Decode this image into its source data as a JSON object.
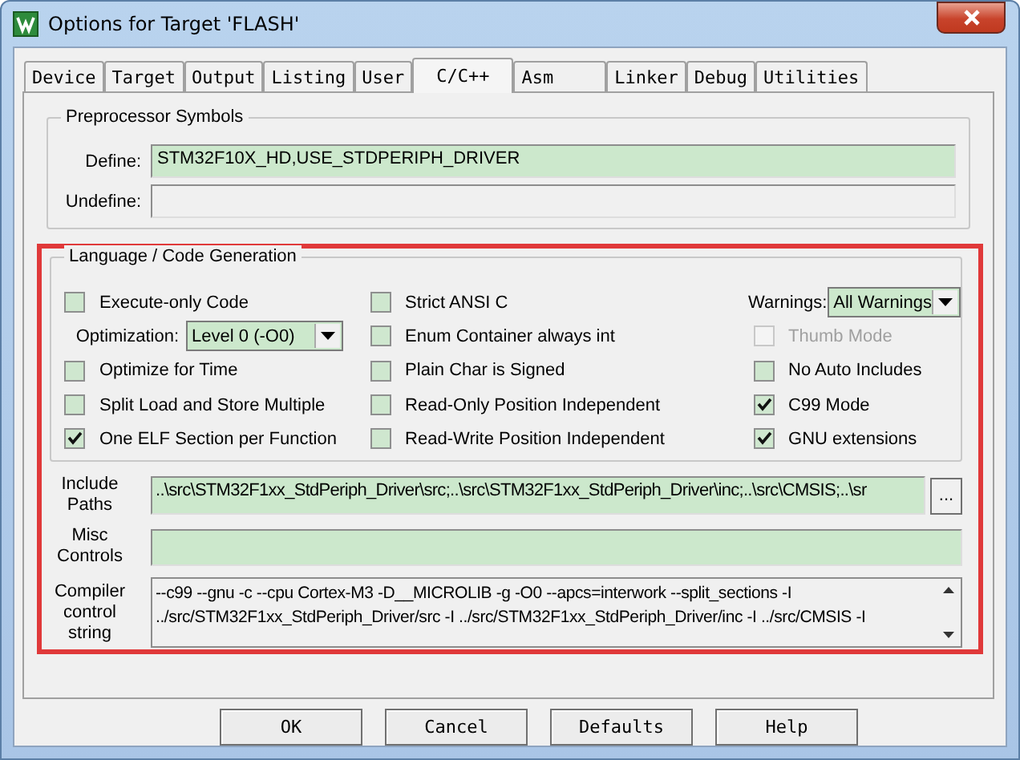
{
  "window": {
    "title": "Options for Target 'FLASH'"
  },
  "tabs": [
    {
      "label": "Device",
      "selected": false
    },
    {
      "label": "Target",
      "selected": false
    },
    {
      "label": "Output",
      "selected": false
    },
    {
      "label": "Listing",
      "selected": false
    },
    {
      "label": "User",
      "selected": false
    },
    {
      "label": "C/C++",
      "selected": true
    },
    {
      "label": "Asm",
      "selected": false
    },
    {
      "label": "Linker",
      "selected": false
    },
    {
      "label": "Debug",
      "selected": false
    },
    {
      "label": "Utilities",
      "selected": false
    }
  ],
  "preprocessor": {
    "title": "Preprocessor Symbols",
    "fields": [
      {
        "label": "Define:",
        "value": "STM32F10X_HD,USE_STDPERIPH_DRIVER",
        "disabled": false
      },
      {
        "label": "Undefine:",
        "disabled": true
      }
    ]
  },
  "language": {
    "title": "Language / Code Generation",
    "highlighted": true,
    "columns": [
      {
        "items": [
          {
            "kind": "checkbox",
            "label": "Execute-only Code",
            "checked": false,
            "disabled": false
          },
          {
            "kind": "dropdown",
            "label": "Optimization:",
            "value": "Level 0 (-O0)"
          },
          {
            "kind": "checkbox",
            "label": "Optimize for Time",
            "checked": false,
            "disabled": false
          },
          {
            "kind": "checkbox",
            "label": "Split Load and Store Multiple",
            "checked": false,
            "disabled": false
          },
          {
            "kind": "checkbox",
            "label": "One ELF Section per Function",
            "checked": true,
            "disabled": false
          }
        ]
      },
      {
        "items": [
          {
            "kind": "checkbox",
            "label": "Strict ANSI C",
            "checked": false,
            "disabled": false
          },
          {
            "kind": "checkbox",
            "label": "Enum Container always int",
            "checked": false,
            "disabled": false
          },
          {
            "kind": "checkbox",
            "label": "Plain Char is Signed",
            "checked": false,
            "disabled": false
          },
          {
            "kind": "checkbox",
            "label": "Read-Only Position Independent",
            "checked": false,
            "disabled": false
          },
          {
            "kind": "checkbox",
            "label": "Read-Write Position Independent",
            "checked": false,
            "disabled": false
          }
        ]
      },
      {
        "items": [
          {
            "kind": "dropdown",
            "label": "Warnings:",
            "value": "All Warnings"
          },
          {
            "kind": "checkbox",
            "label": "Thumb Mode",
            "checked": false,
            "disabled": true
          },
          {
            "kind": "checkbox",
            "label": "No Auto Includes",
            "checked": false,
            "disabled": false
          },
          {
            "kind": "checkbox",
            "label": "C99 Mode",
            "checked": true,
            "disabled": false
          },
          {
            "kind": "checkbox",
            "label": "GNU extensions",
            "checked": true,
            "disabled": false
          }
        ]
      }
    ]
  },
  "include_paths": {
    "label": "Include Paths",
    "value": "..\\src\\STM32F1xx_StdPeriph_Driver\\src;..\\src\\STM32F1xx_StdPeriph_Driver\\inc;..\\src\\CMSIS;..\\sr",
    "browse": "..."
  },
  "misc_controls": {
    "label": "Misc Controls"
  },
  "compiler_string": {
    "label": "Compiler control string",
    "lines": [
      "--c99 --gnu -c --cpu Cortex-M3 -D__MICROLIB -g -O0 --apcs=interwork --split_sections -I",
      "../src/STM32F1xx_StdPeriph_Driver/src -I ../src/STM32F1xx_StdPeriph_Driver/inc -I ../src/CMSIS -I"
    ]
  },
  "buttons": [
    "OK",
    "Cancel",
    "Defaults",
    "Help"
  ]
}
